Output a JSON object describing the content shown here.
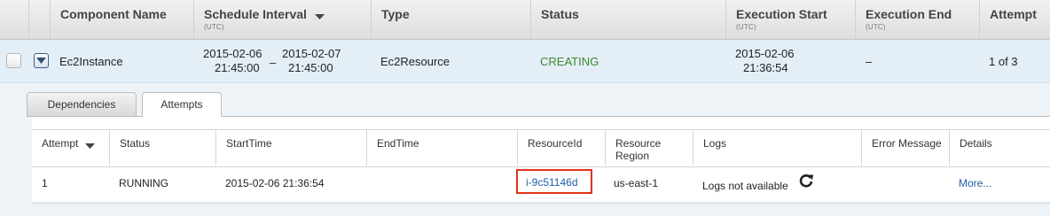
{
  "columns": [
    {
      "label": "Component Name",
      "sub": ""
    },
    {
      "label": "Schedule Interval",
      "sub": "(UTC)"
    },
    {
      "label": "Type",
      "sub": ""
    },
    {
      "label": "Status",
      "sub": ""
    },
    {
      "label": "Execution Start",
      "sub": "(UTC)"
    },
    {
      "label": "Execution End",
      "sub": "(UTC)"
    },
    {
      "label": "Attempt",
      "sub": ""
    }
  ],
  "row": {
    "component_name": "Ec2Instance",
    "schedule_start_date": "2015-02-06",
    "schedule_start_time": "21:45:00",
    "schedule_sep": "–",
    "schedule_end_date": "2015-02-07",
    "schedule_end_time": "21:45:00",
    "type": "Ec2Resource",
    "status": "CREATING",
    "exec_start_date": "2015-02-06",
    "exec_start_time": "21:36:54",
    "exec_end": "–",
    "attempt": "1 of 3"
  },
  "tabs": [
    {
      "label": "Dependencies",
      "active": false
    },
    {
      "label": "Attempts",
      "active": true
    }
  ],
  "attempt_columns": [
    {
      "label": "Attempt"
    },
    {
      "label": "Status"
    },
    {
      "label": "StartTime"
    },
    {
      "label": "EndTime"
    },
    {
      "label": "ResourceId"
    },
    {
      "label": "Resource",
      "label2": "Region"
    },
    {
      "label": "Logs"
    },
    {
      "label": "Error Message"
    },
    {
      "label": "Details"
    }
  ],
  "attempt_row": {
    "attempt": "1",
    "status": "RUNNING",
    "start_time": "2015-02-06 21:36:54",
    "end_time": "",
    "resource_id": "i-9c51146d",
    "region": "us-east-1",
    "logs": "Logs not available",
    "error_message": "",
    "details": "More..."
  },
  "colors": {
    "status_creating": "#3a8a2e",
    "link": "#1d5fa8",
    "highlight_border": "#e0321c"
  },
  "icons": {
    "sort": "sort-down-icon",
    "expander": "chevron-down-icon",
    "refresh": "refresh-icon"
  }
}
